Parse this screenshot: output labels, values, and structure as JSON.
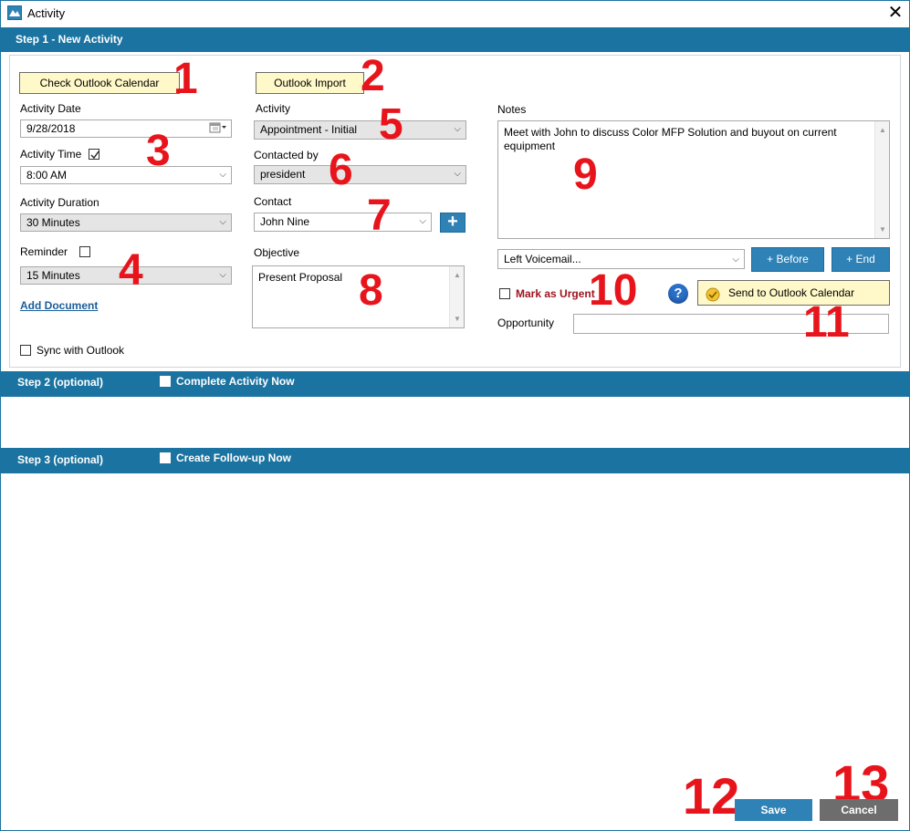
{
  "window": {
    "title": "Activity",
    "close_glyph": "✕"
  },
  "step1": {
    "label": "Step 1 - New Activity",
    "check_outlook_btn": "Check Outlook Calendar",
    "outlook_import_btn": "Outlook Import",
    "activity_date": {
      "label": "Activity Date",
      "value": "9/28/2018"
    },
    "activity_time": {
      "label": "Activity Time",
      "checked": true,
      "value": "8:00 AM"
    },
    "activity_duration": {
      "label": "Activity Duration",
      "value": "30 Minutes"
    },
    "reminder": {
      "label": "Reminder",
      "checked": false,
      "value": "15 Minutes"
    },
    "add_document": "Add Document",
    "sync_outlook": {
      "label": "Sync with Outlook",
      "checked": false
    },
    "activity": {
      "label": "Activity",
      "value": "Appointment - Initial"
    },
    "contacted_by": {
      "label": "Contacted by",
      "value": "president"
    },
    "contact": {
      "label": "Contact",
      "value": "John  Nine",
      "add_glyph": "+"
    },
    "objective": {
      "label": "Objective",
      "value": "Present Proposal"
    },
    "notes": {
      "label": "Notes",
      "value": "Meet with John to discuss Color MFP Solution and buyout on current equipment"
    },
    "note_template": {
      "value": "Left Voicemail...",
      "before_btn": "+ Before",
      "end_btn": "+ End"
    },
    "mark_urgent": {
      "label": "Mark as Urgent",
      "checked": false
    },
    "help_glyph": "?",
    "send_outlook_btn": "Send to Outlook Calendar",
    "opportunity": {
      "label": "Opportunity",
      "value": ""
    }
  },
  "step2": {
    "label": "Step 2 (optional)",
    "option": "Complete Activity Now",
    "checked": false
  },
  "step3": {
    "label": "Step 3 (optional)",
    "option": "Create Follow-up Now",
    "checked": false
  },
  "footer": {
    "save": "Save",
    "cancel": "Cancel"
  },
  "annotations": [
    "1",
    "2",
    "3",
    "4",
    "5",
    "6",
    "7",
    "8",
    "9",
    "10",
    "11",
    "12",
    "13"
  ],
  "colors": {
    "accent": "#1a73a0",
    "annotation": "#e8141c",
    "yellow_button": "#fff8c8",
    "save": "#2e82b6",
    "cancel": "#6d6d6d"
  },
  "icons": [
    "app-icon",
    "close-icon",
    "calendar-icon",
    "chevron-down-icon",
    "check-icon",
    "plus-icon",
    "help-icon",
    "outlook-icon"
  ]
}
